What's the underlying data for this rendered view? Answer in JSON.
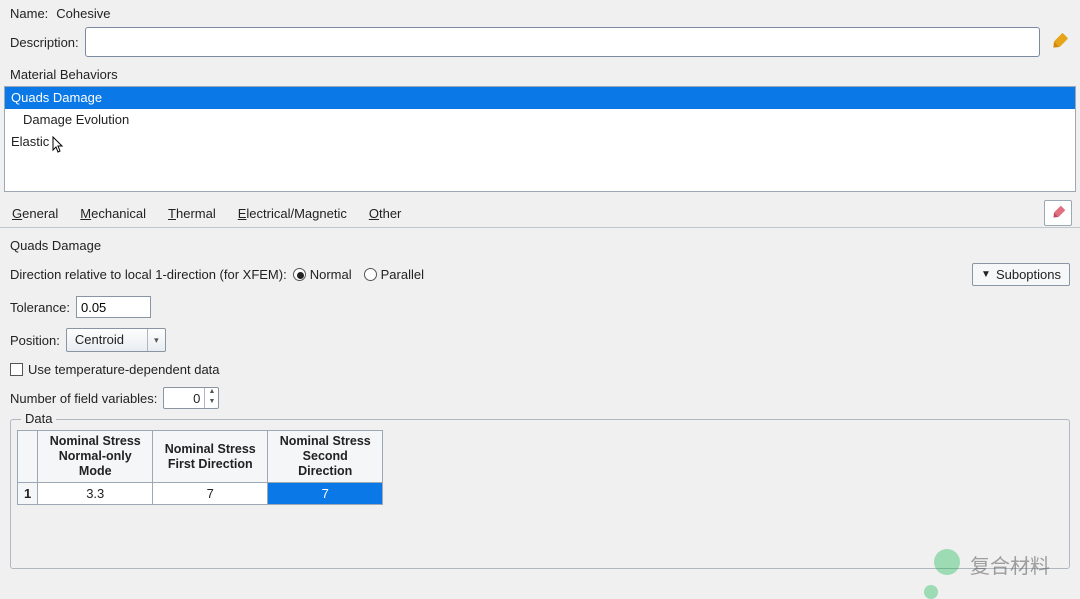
{
  "header": {
    "name_label": "Name:",
    "name_value": "Cohesive",
    "description_label": "Description:",
    "description_value": ""
  },
  "behaviors": {
    "section_label": "Material Behaviors",
    "items": [
      {
        "label": "Quads Damage",
        "selected": true,
        "indent": false
      },
      {
        "label": "Damage Evolution",
        "selected": false,
        "indent": true
      },
      {
        "label": "Elastic",
        "selected": false,
        "indent": false
      }
    ]
  },
  "tabs": [
    {
      "hotkey": "G",
      "rest": "eneral"
    },
    {
      "hotkey": "M",
      "rest": "echanical"
    },
    {
      "hotkey": "T",
      "rest": "hermal"
    },
    {
      "hotkey": "E",
      "rest": "lectrical/Magnetic"
    },
    {
      "hotkey": "O",
      "rest": "ther"
    }
  ],
  "panel": {
    "title": "Quads Damage",
    "direction_label": "Direction relative to local 1-direction (for XFEM):",
    "radio_normal": "Normal",
    "radio_parallel": "Parallel",
    "direction_value": "Normal",
    "suboptions_label": "Suboptions",
    "tolerance_label": "Tolerance:",
    "tolerance_value": "0.05",
    "position_label": "Position:",
    "position_value": "Centroid",
    "temp_dep_label": "Use temperature-dependent data",
    "temp_dep_checked": false,
    "field_vars_label": "Number of field variables:",
    "field_vars_value": "0"
  },
  "data_table": {
    "legend": "Data",
    "headers": [
      "Nominal Stress\nNormal-only Mode",
      "Nominal Stress\nFirst Direction",
      "Nominal Stress\nSecond Direction"
    ],
    "rows": [
      {
        "n": "1",
        "cells": [
          "3.3",
          "7",
          "7"
        ],
        "selected_col": 2
      }
    ]
  },
  "watermark": "复合材料"
}
